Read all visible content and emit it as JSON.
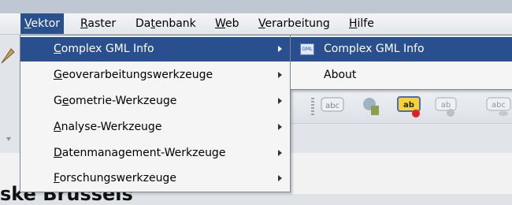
{
  "menubar": {
    "items": [
      {
        "label": "Vektor",
        "accel": "V",
        "rest": "ektor"
      },
      {
        "label": "Raster",
        "accel": "R",
        "rest": "aster"
      },
      {
        "pre": "Da",
        "accel": "t",
        "rest": "enbank"
      },
      {
        "label": "Web",
        "accel": "W",
        "rest": "eb"
      },
      {
        "pre": "",
        "accel": "V",
        "rest": "erarbeitung"
      },
      {
        "label": "Hilfe",
        "accel": "H",
        "rest": "ilfe"
      }
    ]
  },
  "vektor_menu": {
    "items": [
      {
        "label": "Complex GML Info",
        "accel": "C",
        "rest": "omplex GML Info"
      },
      {
        "label": "Geoverarbeitungswerkzeuge",
        "accel": "G",
        "rest": "eoverarbeitungswerkzeuge"
      },
      {
        "pre": "G",
        "accel": "e",
        "rest": "ometrie-Werkzeuge"
      },
      {
        "label": "Analyse-Werkzeuge",
        "accel": "A",
        "rest": "nalyse-Werkzeuge"
      },
      {
        "label": "Datenmanagement-Werkzeuge",
        "accel": "D",
        "rest": "atenmanagement-Werkzeuge"
      },
      {
        "label": "Forschungswerkzeuge",
        "accel": "F",
        "rest": "orschungswerkzeuge"
      }
    ]
  },
  "submenu": {
    "items": [
      {
        "label": "Complex GML Info",
        "icon": "gml-icon",
        "icon_text": "GML"
      },
      {
        "label": "About"
      }
    ]
  },
  "toolbar": {
    "label_icons": [
      "abc",
      "ab",
      "ab",
      "abc"
    ]
  },
  "background": {
    "heading_fragment": "ske Brussels"
  },
  "colors": {
    "highlight": "#2a4f8f",
    "menu_bg": "#f5f5f5"
  }
}
